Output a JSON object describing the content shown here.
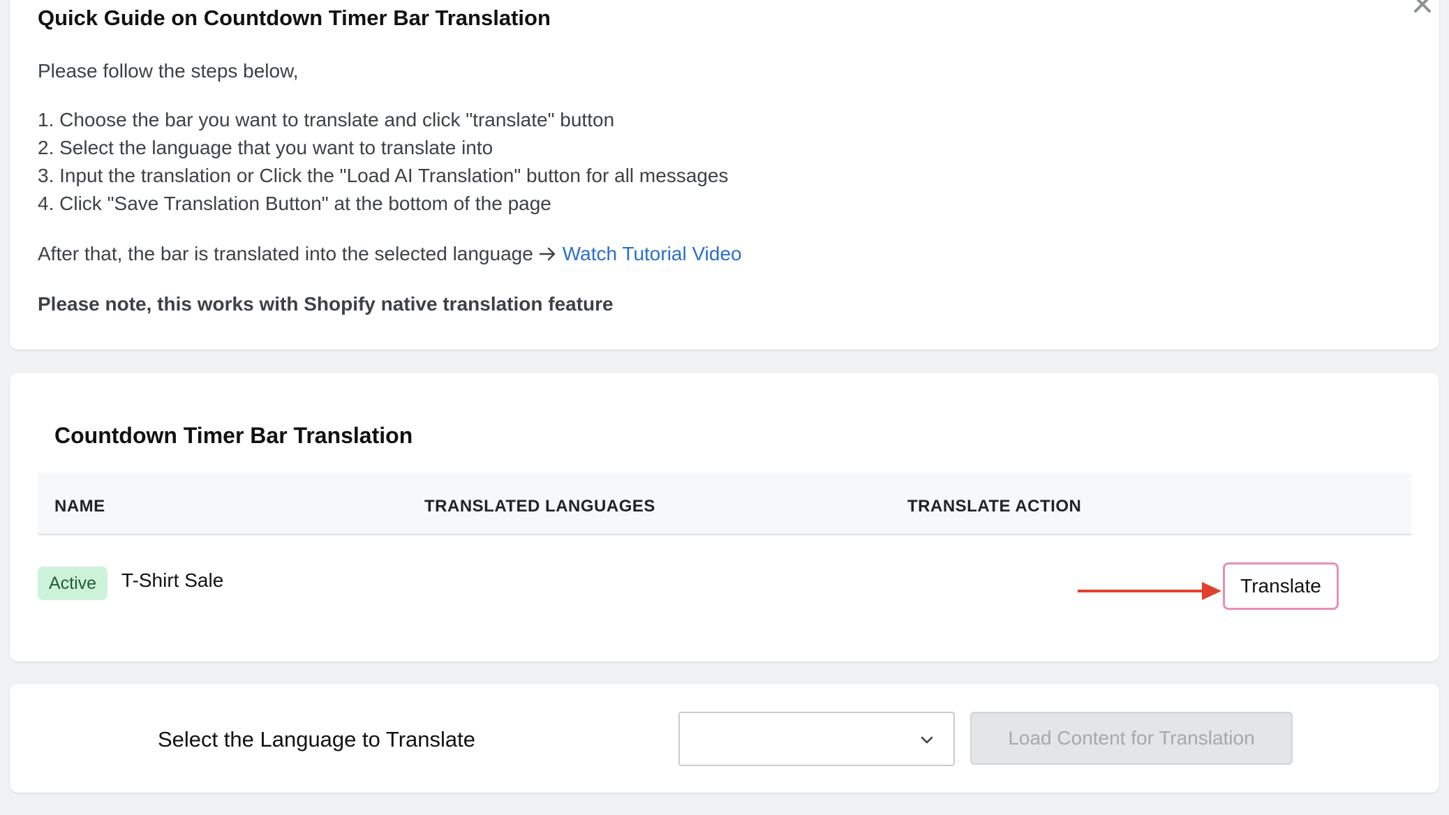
{
  "guide": {
    "title": "Quick Guide on Countdown Timer Bar Translation",
    "intro": "Please follow the steps below,",
    "steps": [
      "1. Choose the bar you want to translate and click \"translate\" button",
      "2. Select the language that you want to translate into",
      "3. Input the translation or Click the \"Load AI Translation\" button for all messages",
      "4. Click \"Save Translation Button\" at the bottom of the page"
    ],
    "after_text": "After that, the bar is translated into the selected language",
    "link_label": "Watch Tutorial Video",
    "note": "Please note, this works with Shopify native translation feature"
  },
  "table": {
    "title": "Countdown Timer Bar Translation",
    "headers": {
      "name": "NAME",
      "languages": "TRANSLATED LANGUAGES",
      "action": "TRANSLATE ACTION"
    },
    "rows": [
      {
        "status": "Active",
        "name": "T-Shirt Sale",
        "languages": "",
        "action_label": "Translate"
      }
    ]
  },
  "bottom": {
    "label": "Select the Language to Translate",
    "selected_language": "",
    "load_button": "Load Content for Translation"
  },
  "colors": {
    "link": "#2c6ecb",
    "badge_bg": "#cdf2da",
    "highlight_border": "#e78fb6",
    "annotation_arrow": "#e0412c"
  }
}
